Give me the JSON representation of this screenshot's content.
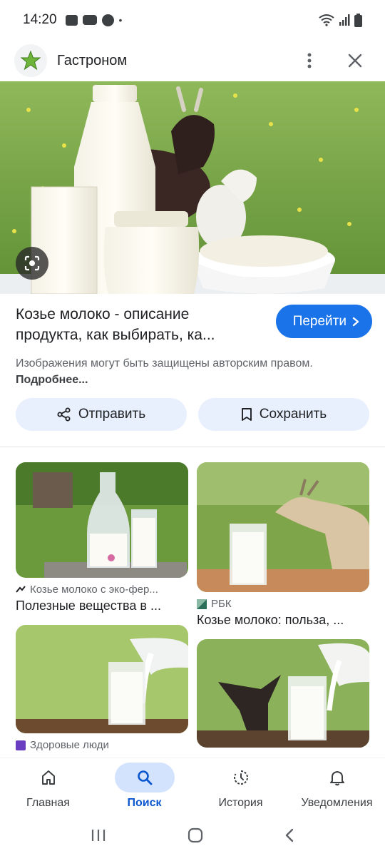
{
  "status": {
    "time": "14:20",
    "dot": "•"
  },
  "header": {
    "site_name": "Гастроном"
  },
  "result": {
    "title": "Козье молоко - описание продукта, как выбирать, ка...",
    "visit_label": "Перейти",
    "copyright_text": "Изображения могут быть защищены авторским правом.",
    "copyright_link": "Подробнее..."
  },
  "actions": {
    "share_label": "Отправить",
    "save_label": "Сохранить"
  },
  "related": [
    {
      "source": "Козье молоко с эко-фер...",
      "title": "Полезные вещества в ..."
    },
    {
      "source": "РБК",
      "title": "Козье молоко: польза, ..."
    },
    {
      "source": "Здоровые люди",
      "title": ""
    },
    {
      "source": "",
      "title": ""
    }
  ],
  "bottom_nav": [
    {
      "label": "Главная"
    },
    {
      "label": "Поиск"
    },
    {
      "label": "История"
    },
    {
      "label": "Уведомления"
    }
  ],
  "colors": {
    "accent": "#1a73e8",
    "action_bg": "#e8f0fe",
    "active_nav": "#d3e3fd"
  }
}
